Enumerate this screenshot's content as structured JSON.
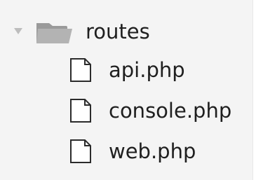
{
  "tree": {
    "folder": {
      "label": "routes",
      "expanded": true,
      "icon": "folder-icon",
      "toggle_icon": "chevron-down-icon"
    },
    "files": [
      {
        "label": "api.php",
        "icon": "file-icon"
      },
      {
        "label": "console.php",
        "icon": "file-icon"
      },
      {
        "label": "web.php",
        "icon": "file-icon"
      }
    ]
  },
  "colors": {
    "background": "#f4f4f4",
    "text": "#1f1f1f",
    "folder_fill": "#9a9a9a",
    "icon_outline": "#2b2b2b",
    "toggle": "#bdbdbd"
  }
}
